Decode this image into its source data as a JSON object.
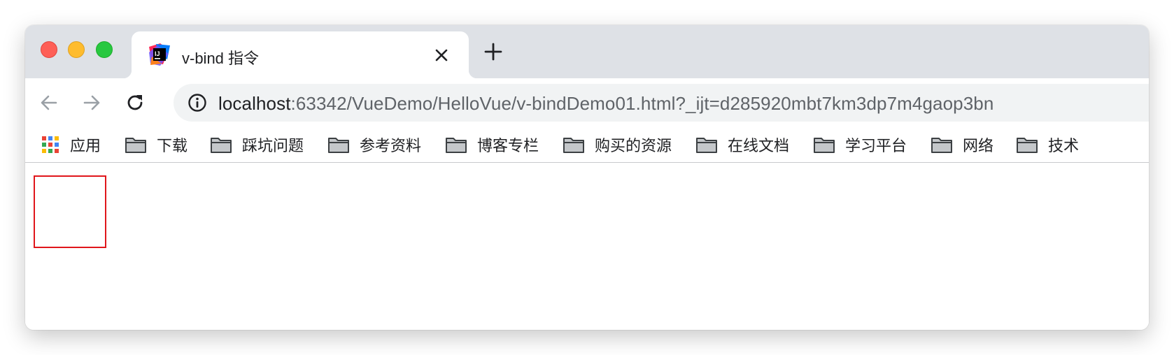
{
  "window": {
    "controls": {
      "close": "close-window-control",
      "minimize": "minimize-window-control",
      "maximize": "maximize-window-control"
    }
  },
  "tab": {
    "title": "v-bind 指令",
    "favicon": "intellij-idea-icon",
    "close_icon": "close-icon"
  },
  "newtab_icon": "plus-icon",
  "toolbar": {
    "back_icon": "arrow-left-icon",
    "forward_icon": "arrow-right-icon",
    "reload_icon": "reload-icon",
    "info_icon": "info-icon",
    "url_host": "localhost",
    "url_rest": ":63342/VueDemo/HelloVue/v-bindDemo01.html?_ijt=d285920mbt7km3dp7m4gaop3bn"
  },
  "bookmarks": {
    "apps_label": "应用",
    "items": [
      {
        "label": "下载"
      },
      {
        "label": "踩坑问题"
      },
      {
        "label": "参考资料"
      },
      {
        "label": "博客专栏"
      },
      {
        "label": "购买的资源"
      },
      {
        "label": "在线文档"
      },
      {
        "label": "学习平台"
      },
      {
        "label": "网络"
      },
      {
        "label": "技术"
      }
    ]
  },
  "content": {
    "box_border_color": "#e0161b"
  }
}
